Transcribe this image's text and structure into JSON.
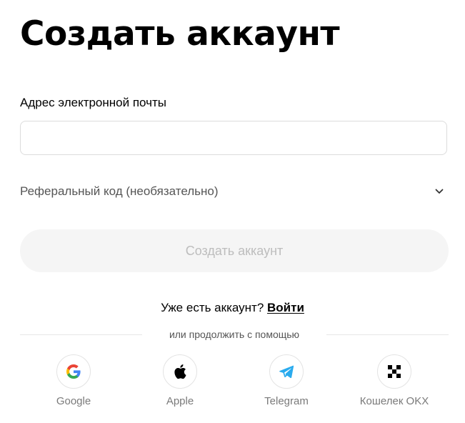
{
  "page": {
    "title": "Создать аккаунт"
  },
  "email": {
    "label": "Адрес электронной почты",
    "value": "",
    "placeholder": ""
  },
  "referral": {
    "label": "Реферальный код (необязательно)",
    "icon": "chevron-down-icon"
  },
  "create_button": {
    "label": "Создать аккаунт",
    "state": "disabled"
  },
  "login": {
    "prompt": "Уже есть аккаунт?",
    "link_label": "Войти"
  },
  "divider": {
    "text": "или продолжить с помощью"
  },
  "providers": [
    {
      "label": "Google",
      "icon": "google-icon"
    },
    {
      "label": "Apple",
      "icon": "apple-icon"
    },
    {
      "label": "Telegram",
      "icon": "telegram-icon"
    },
    {
      "label": "Кошелек OKX",
      "icon": "okx-icon"
    }
  ],
  "colors": {
    "text_primary": "#000000",
    "text_secondary": "#555555",
    "button_disabled_bg": "#f5f5f5",
    "button_disabled_text": "#bdbdbd",
    "border": "#dcdcdc",
    "telegram_blue": "#2aabee"
  }
}
